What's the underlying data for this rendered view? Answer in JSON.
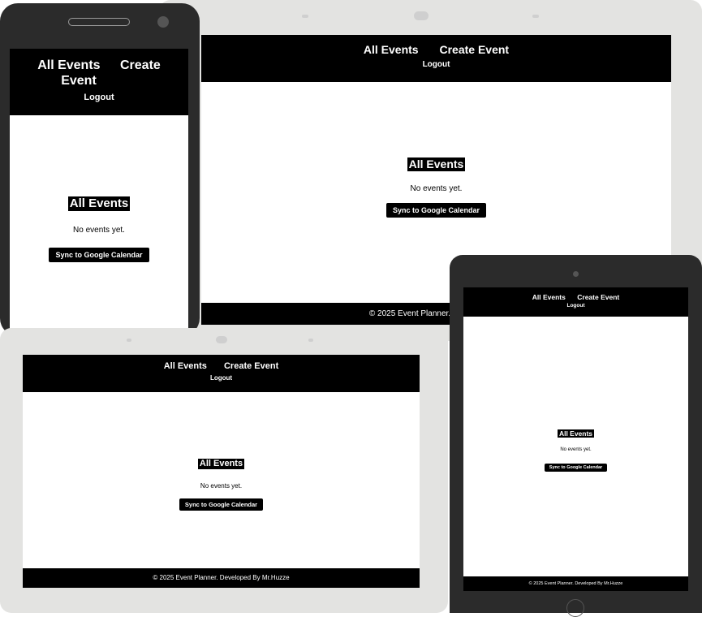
{
  "nav": {
    "all_events": "All Events",
    "create_event": "Create Event",
    "create_word": "Create",
    "event_word": "Event",
    "logout": "Logout"
  },
  "main": {
    "heading": "All Events",
    "empty_message": "No events yet.",
    "sync_button": "Sync to Google Calendar"
  },
  "footer": {
    "text": "© 2025 Event Planner. Developed By Mr.Huzze"
  },
  "colors": {
    "nav_bg": "#000000",
    "frame_light": "#e3e3e1",
    "frame_dark": "#2b2b2b"
  }
}
